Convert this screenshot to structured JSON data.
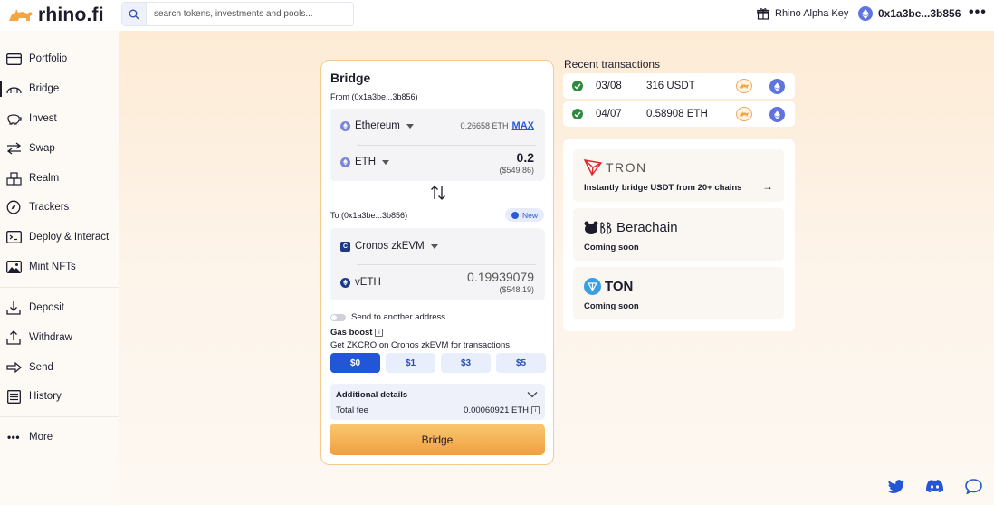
{
  "app": {
    "logo_text": "rhino.fi"
  },
  "search": {
    "placeholder": "search tokens, investments and pools..."
  },
  "header": {
    "alpha_key_label": "Rhino Alpha Key",
    "wallet_address": "0x1a3be...3b856",
    "more_label": "•••"
  },
  "sidebar": {
    "items": [
      {
        "label": "Portfolio",
        "icon": "card-icon"
      },
      {
        "label": "Bridge",
        "icon": "bridge-icon"
      },
      {
        "label": "Invest",
        "icon": "piggy-bank-icon"
      },
      {
        "label": "Swap",
        "icon": "swap-icon"
      },
      {
        "label": "Realm",
        "icon": "cubes-icon"
      },
      {
        "label": "Trackers",
        "icon": "compass-icon"
      },
      {
        "label": "Deploy & Interact",
        "icon": "terminal-icon"
      },
      {
        "label": "Mint NFTs",
        "icon": "image-icon"
      }
    ],
    "secondary_items": [
      {
        "label": "Deposit",
        "icon": "download-icon"
      },
      {
        "label": "Withdraw",
        "icon": "upload-icon"
      },
      {
        "label": "Send",
        "icon": "arrow-right-icon"
      },
      {
        "label": "History",
        "icon": "list-icon"
      }
    ],
    "more_label": "More",
    "active": "Bridge"
  },
  "bridge": {
    "title": "Bridge",
    "from_label": "From (0x1a3be...3b856)",
    "from_chain": "Ethereum",
    "from_balance": "0.26658 ETH",
    "max_label": "MAX",
    "from_token": "ETH",
    "from_amount": "0.2",
    "from_usd": "($549.86)",
    "to_label": "To (0x1a3be...3b856)",
    "new_badge": "New",
    "to_chain": "Cronos zkEVM",
    "to_token": "vETH",
    "to_amount": "0.19939079",
    "to_usd": "($548.19)",
    "send_other_label": "Send to another address",
    "gas_title": "Gas boost",
    "gas_desc": "Get ZKCRO on Cronos zkEVM for transactions.",
    "gas_options": [
      "$0",
      "$1",
      "$3",
      "$5"
    ],
    "gas_selected": "$0",
    "details_title": "Additional details",
    "fee_label": "Total fee",
    "fee_value": "0.00060921 ETH",
    "submit_label": "Bridge"
  },
  "recent": {
    "title": "Recent transactions",
    "rows": [
      {
        "date": "03/08",
        "amount": "316 USDT"
      },
      {
        "date": "04/07",
        "amount": "0.58908 ETH"
      }
    ]
  },
  "promos": [
    {
      "name": "TRON",
      "subtitle": "Instantly bridge USDT from 20+ chains",
      "icon": "tron-logo-icon",
      "color": "#e0262c"
    },
    {
      "name": "Berachain",
      "subtitle": "Coming soon",
      "icon": "berachain-logo-icon"
    },
    {
      "name": "TON",
      "subtitle": "Coming soon",
      "icon": "ton-logo-icon",
      "color": "#3a9fe0"
    }
  ],
  "colors": {
    "accent_blue": "#2256d6",
    "bridge_button": "#f19f3f",
    "success": "#2e8a3e",
    "eth": "#6074e0"
  },
  "social": [
    "twitter-icon",
    "discord-icon",
    "chat-icon"
  ]
}
